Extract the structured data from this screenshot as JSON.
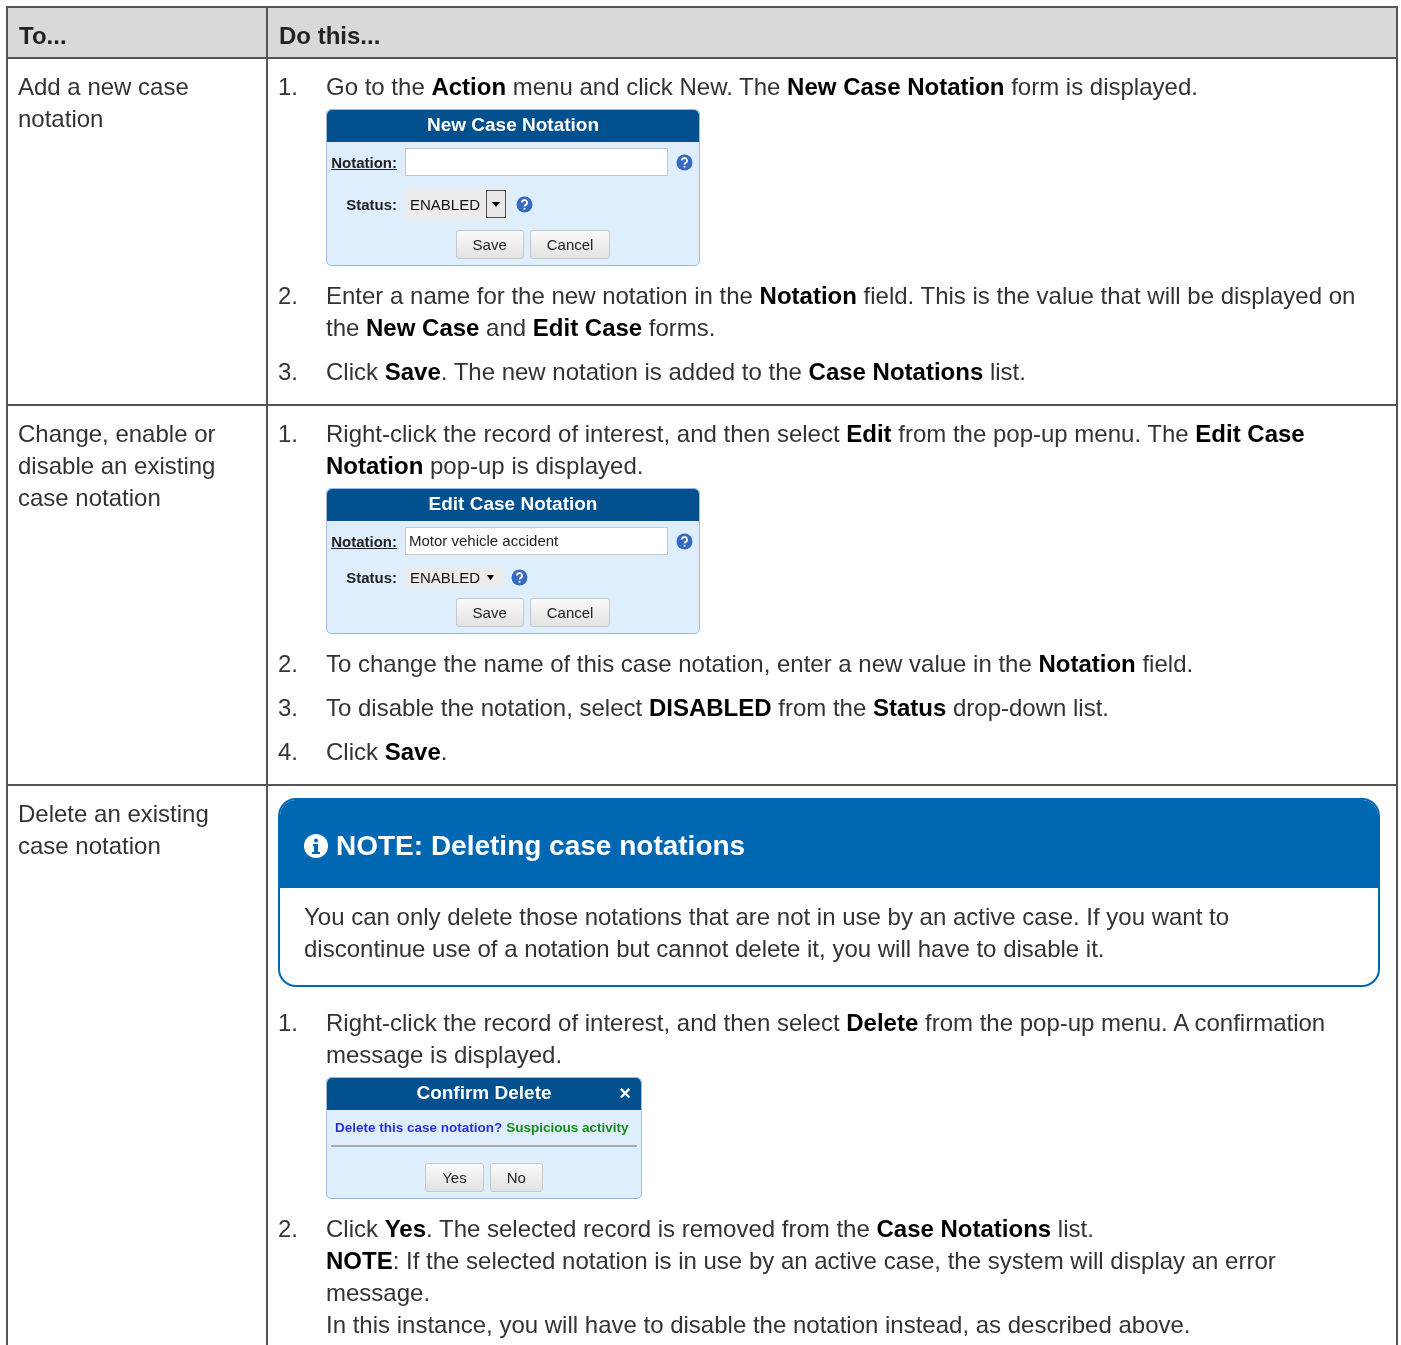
{
  "table": {
    "columns": [
      "To...",
      "Do this..."
    ],
    "rows": [
      {
        "task": "Add a new case notation",
        "content": [
          {
            "kind": "step",
            "number": "1.",
            "paragraphs": [
              "Go to the **Action** menu and click New. The **New Case Notation** form is displayed."
            ],
            "dialog": {
              "kind": "form",
              "title": "New Case Notation",
              "notation_label": "Notation:",
              "status_label": "Status:",
              "status_value": "ENABLED",
              "arrow_button": true,
              "buttons": [
                "Save",
                "Cancel"
              ]
            }
          },
          {
            "kind": "step",
            "number": "2.",
            "paragraphs": [
              "Enter a name for the new notation in the **Notation** field. This is the value that will be displayed on the **New Case** and **Edit Case** forms."
            ]
          },
          {
            "kind": "step",
            "number": "3.",
            "paragraphs": [
              "Click **Save**. The new notation is added to the **Case Notations** list."
            ]
          }
        ]
      },
      {
        "task": "Change, enable or disable an existing case notation",
        "content": [
          {
            "kind": "step",
            "number": "1.",
            "paragraphs": [
              "Right-click the record of interest, and then select **Edit** from the pop-up menu. The **Edit Case Notation** pop-up is displayed."
            ],
            "dialog": {
              "kind": "form",
              "title": "Edit Case Notation",
              "notation_label": "Notation:",
              "notation_value": "Motor vehicle accident",
              "status_label": "Status:",
              "status_value": "ENABLED",
              "arrow_button": false,
              "buttons": [
                "Save",
                "Cancel"
              ]
            }
          },
          {
            "kind": "step",
            "number": "2.",
            "paragraphs": [
              "To change the name of this case notation, enter a new value in the **Notation** field."
            ]
          },
          {
            "kind": "step",
            "number": "3.",
            "paragraphs": [
              "To disable the notation, select **DISABLED** from the **Status** drop-down list."
            ]
          },
          {
            "kind": "step",
            "number": "4.",
            "paragraphs": [
              "Click **Save**."
            ]
          }
        ]
      },
      {
        "task": "Delete an existing case notation",
        "content": [
          {
            "kind": "note",
            "title": "NOTE: Deleting case notations",
            "text": "You can only delete those notations that are not in use by an active case. If you want to discontinue use of a notation but cannot delete it, you will have to disable it."
          },
          {
            "kind": "step",
            "number": "1.",
            "paragraphs": [
              "Right-click the record of interest, and then select **Delete** from the pop-up menu. A confirmation message is displayed."
            ],
            "dialog": {
              "kind": "confirm",
              "title": "Confirm Delete",
              "close": "×",
              "message": "Delete this case notation?",
              "subject": "Suspicious activity",
              "buttons": [
                "Yes",
                "No"
              ]
            }
          },
          {
            "kind": "step",
            "number": "2.",
            "paragraphs": [
              "Click **Yes**. The selected record is removed from the **Case Notations** list.",
              "**NOTE**: If the selected notation is in use by an active case, the system will display an error message.",
              "In this instance, you will have to disable the notation instead, as described above."
            ]
          }
        ]
      }
    ]
  }
}
